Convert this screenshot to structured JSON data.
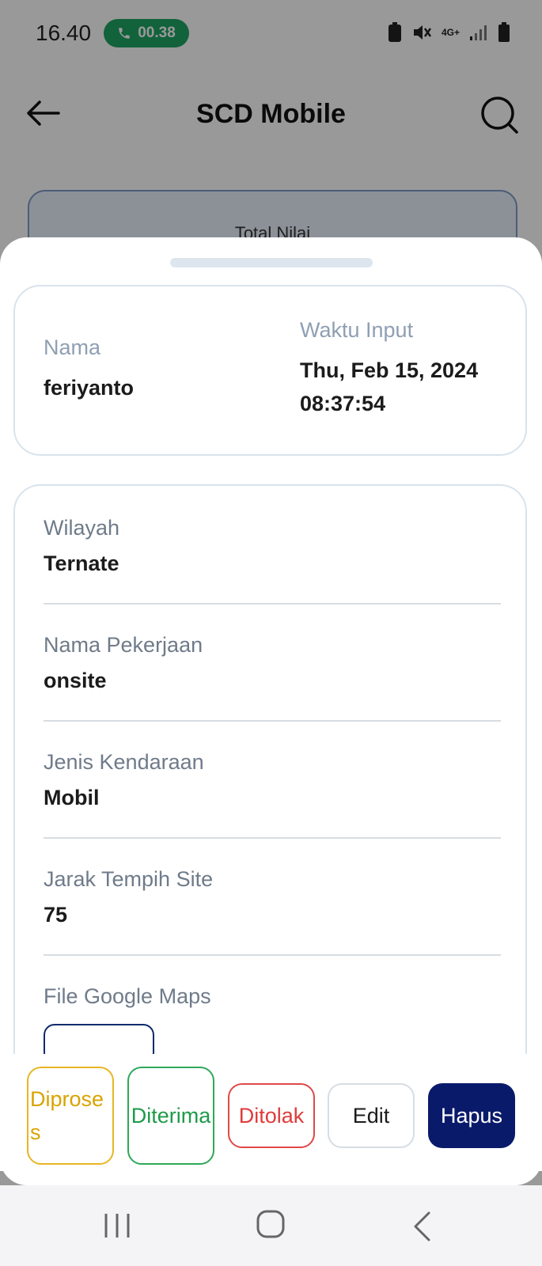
{
  "status_bar": {
    "time": "16.40",
    "call_timer": "00.38",
    "network": "4G+"
  },
  "app_bar": {
    "title": "SCD Mobile"
  },
  "background": {
    "total_label": "Total Nilai"
  },
  "sheet": {
    "summary": {
      "name_label": "Nama",
      "name_value": "feriyanto",
      "time_label": "Waktu Input",
      "time_value_line1": "Thu, Feb 15, 2024",
      "time_value_line2": "08:37:54"
    },
    "fields": [
      {
        "label": "Wilayah",
        "value": "Ternate"
      },
      {
        "label": "Nama Pekerjaan",
        "value": "onsite"
      },
      {
        "label": "Jenis Kendaraan",
        "value": "Mobil"
      },
      {
        "label": "Jarak Tempih Site",
        "value": "75"
      },
      {
        "label": "File Google Maps"
      }
    ],
    "actions": {
      "diproses": "Diproses",
      "diterima": "Diterima",
      "ditolak": "Ditolak",
      "edit": "Edit",
      "hapus": "Hapus"
    }
  },
  "colors": {
    "primary": "#0a1a6b",
    "diproses": "#e8b623",
    "diterima": "#2fa858",
    "ditolak": "#e04848",
    "call_pill": "#1fa463"
  }
}
